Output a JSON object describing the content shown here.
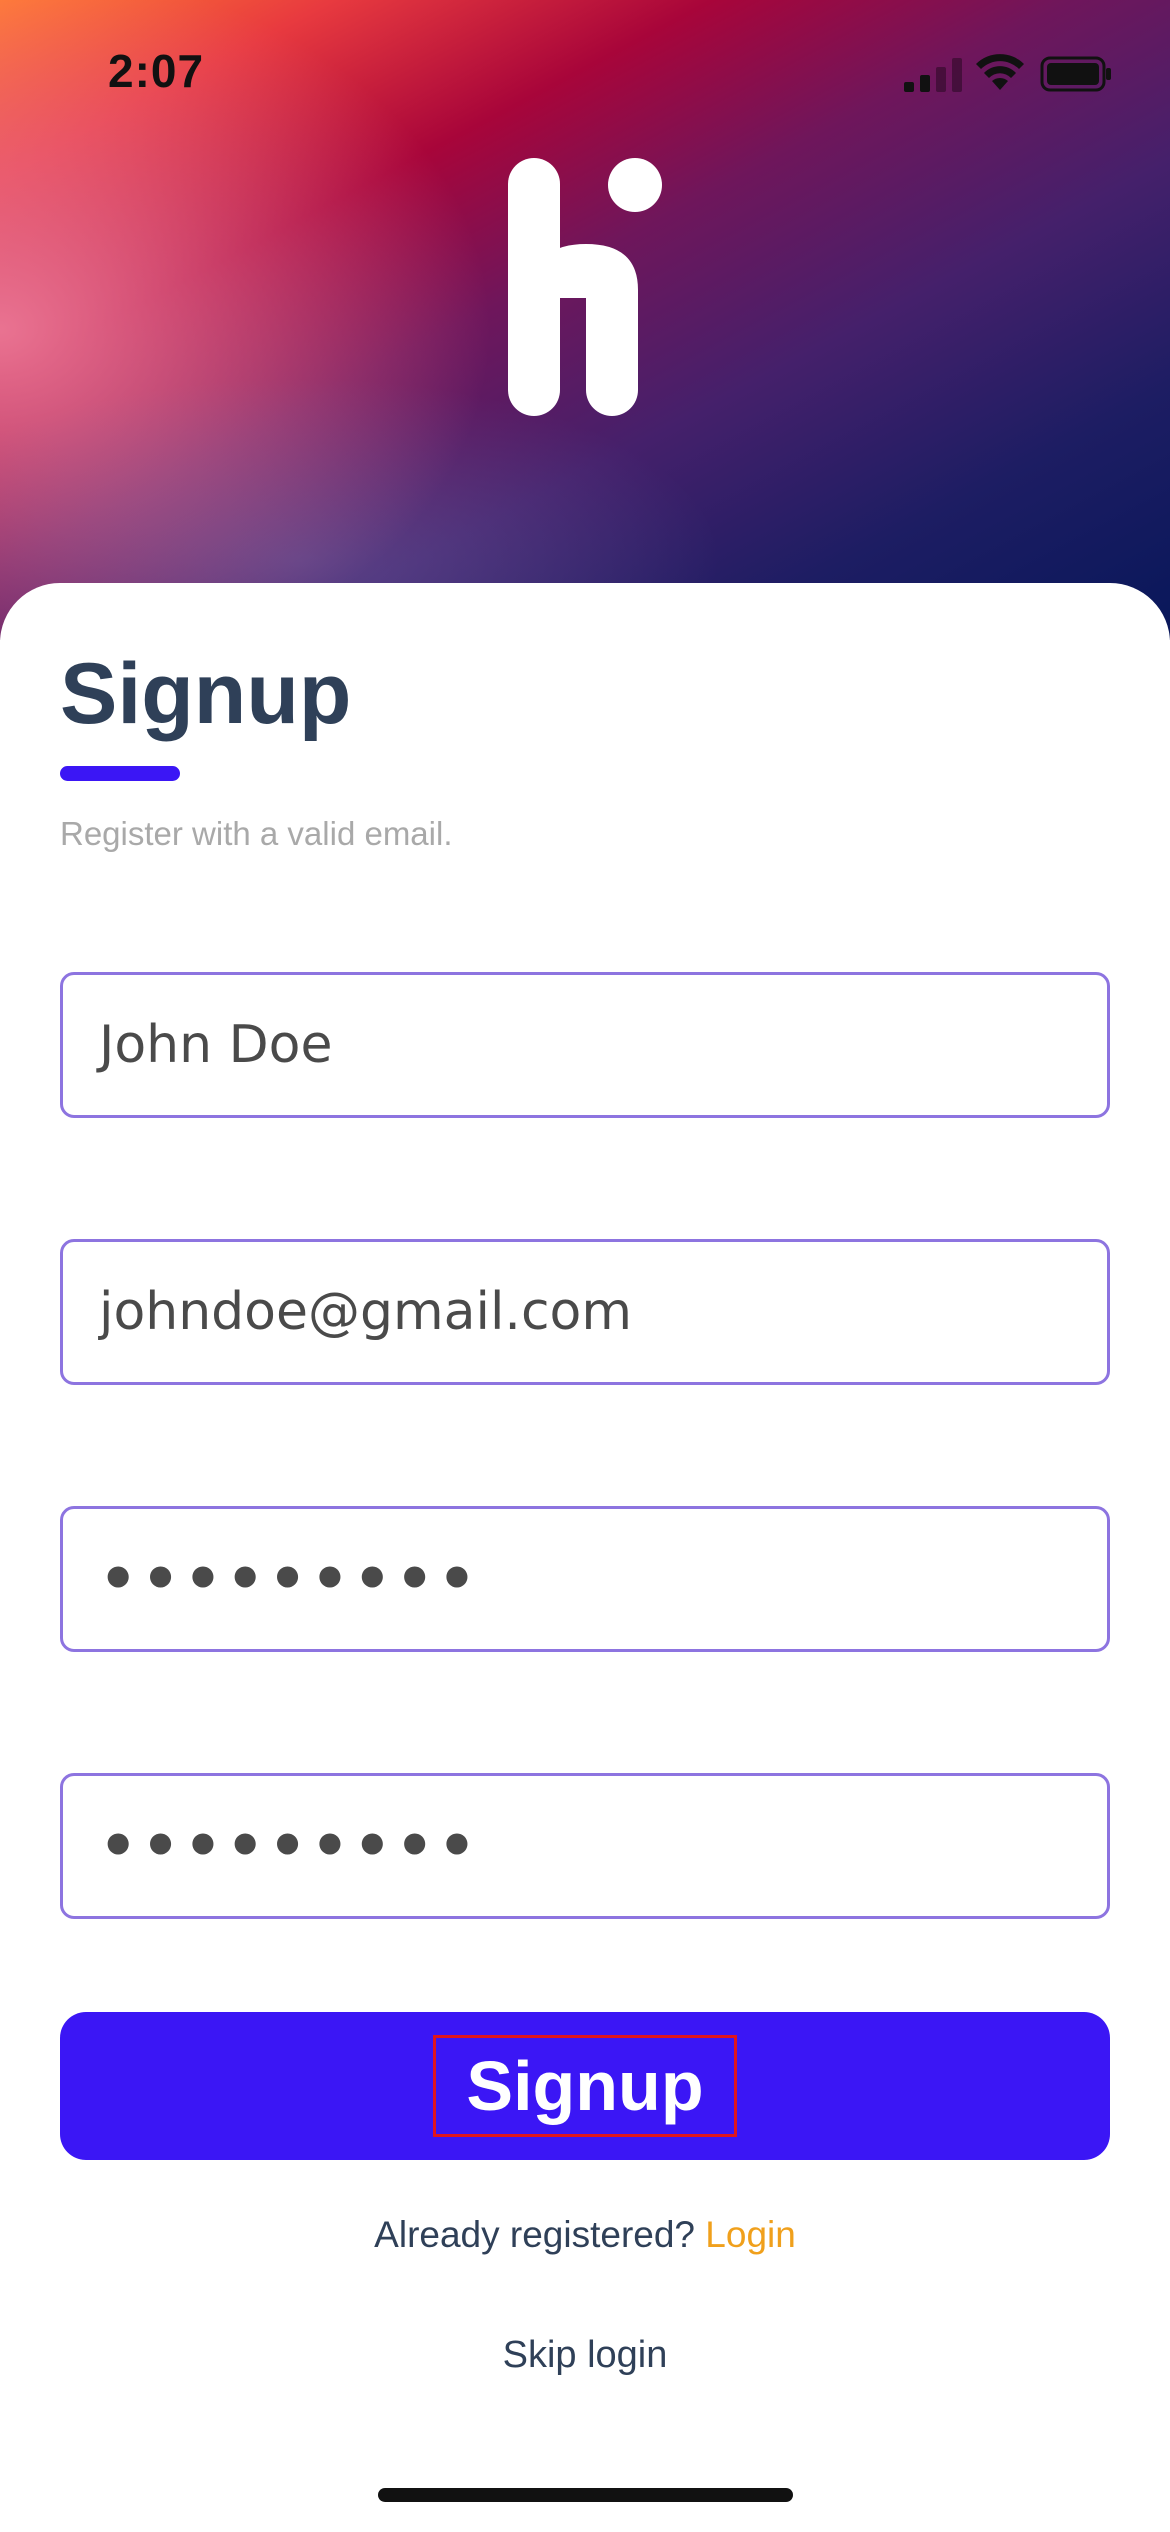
{
  "status_bar": {
    "time": "2:07"
  },
  "logo": {
    "icon": "hi-logo"
  },
  "signup": {
    "title": "Signup",
    "subtitle": "Register with a valid email.",
    "fields": {
      "name_value": "John Doe",
      "email_value": "johndoe@gmail.com",
      "password_value": "•••••••••",
      "confirm_password_value": "•••••••••"
    },
    "button_label": "Signup",
    "already_registered": "Already registered?",
    "login_link": "Login",
    "skip_login": "Skip login"
  },
  "colors": {
    "accent": "#3b16f5",
    "title": "#2f4058",
    "link": "#f0a01c",
    "field_border": "#8d74e0"
  }
}
